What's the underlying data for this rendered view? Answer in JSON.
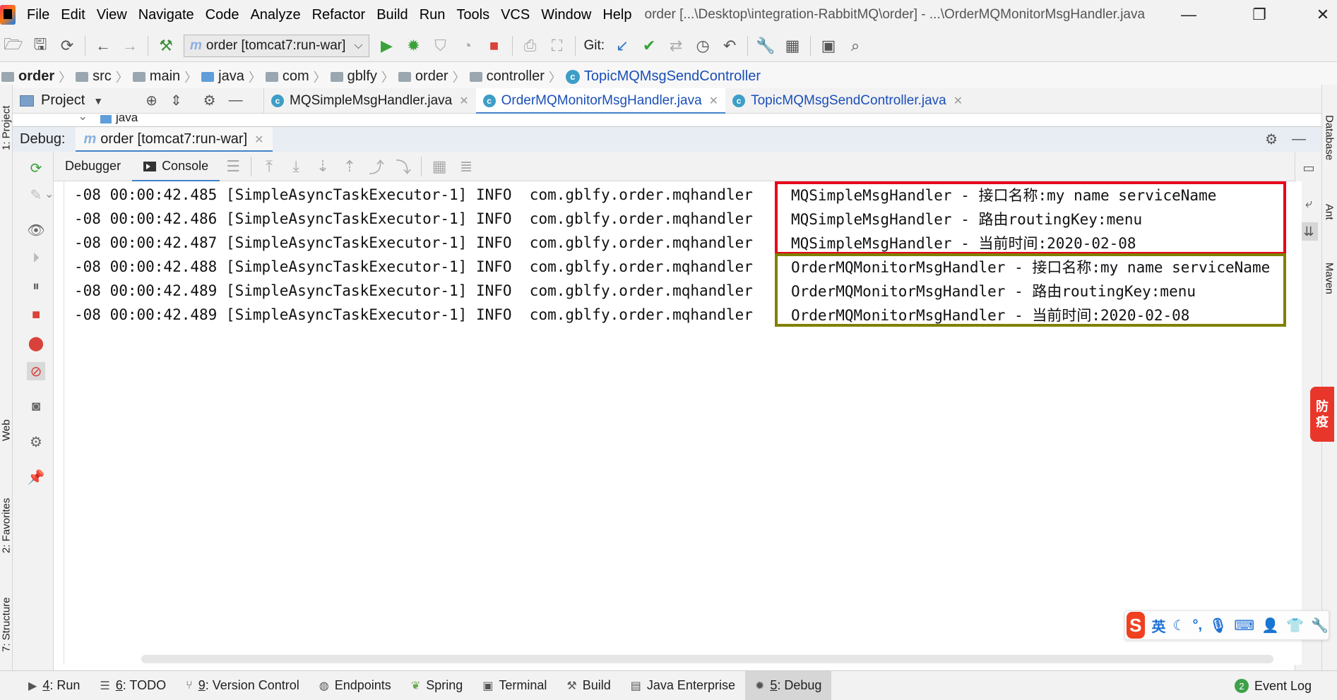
{
  "menubar": {
    "items": [
      "File",
      "Edit",
      "View",
      "Navigate",
      "Code",
      "Analyze",
      "Refactor",
      "Build",
      "Run",
      "Tools",
      "VCS",
      "Window",
      "Help"
    ],
    "title": "order [...\\Desktop\\integration-RabbitMQ\\order] - ...\\OrderMQMonitorMsgHandler.java",
    "minimize": "—",
    "restore": "❐",
    "close": "✕"
  },
  "toolbar": {
    "run_config": "order [tomcat7:run-war]",
    "git_label": "Git:"
  },
  "breadcrumb": {
    "items": [
      "order",
      "src",
      "main",
      "java",
      "com",
      "gblfy",
      "order",
      "controller"
    ],
    "class": "TopicMQMsgSendController"
  },
  "project_pane": {
    "label": "Project",
    "peek_node": "java"
  },
  "editor_tabs": [
    {
      "label": "MQSimpleMsgHandler.java",
      "active": false
    },
    {
      "label": "OrderMQMonitorMsgHandler.java",
      "active": true
    },
    {
      "label": "TopicMQMsgSendController.java",
      "active": false
    }
  ],
  "debug": {
    "label": "Debug:",
    "session": "order [tomcat7:run-war]",
    "subtabs": [
      "Debugger",
      "Console"
    ]
  },
  "console": {
    "lines": [
      {
        "prefix": "-08 00:00:42.485 [SimpleAsyncTaskExecutor-1] INFO  com.gblfy.order.mqhandler",
        "message": "MQSimpleMsgHandler - 接口名称:my name serviceName"
      },
      {
        "prefix": "-08 00:00:42.486 [SimpleAsyncTaskExecutor-1] INFO  com.gblfy.order.mqhandler",
        "message": "MQSimpleMsgHandler - 路由routingKey:menu"
      },
      {
        "prefix": "-08 00:00:42.487 [SimpleAsyncTaskExecutor-1] INFO  com.gblfy.order.mqhandler",
        "message": "MQSimpleMsgHandler - 当前时间:2020-02-08"
      },
      {
        "prefix": "-08 00:00:42.488 [SimpleAsyncTaskExecutor-1] INFO  com.gblfy.order.mqhandler",
        "message": "OrderMQMonitorMsgHandler - 接口名称:my name serviceName"
      },
      {
        "prefix": "-08 00:00:42.489 [SimpleAsyncTaskExecutor-1] INFO  com.gblfy.order.mqhandler",
        "message": "OrderMQMonitorMsgHandler - 路由routingKey:menu"
      },
      {
        "prefix": "-08 00:00:42.489 [SimpleAsyncTaskExecutor-1] INFO  com.gblfy.order.mqhandler",
        "message": "OrderMQMonitorMsgHandler - 当前时间:2020-02-08"
      }
    ],
    "highlight_colors": {
      "first_group": "#e8001c",
      "second_group": "#808000"
    }
  },
  "left_stripe": {
    "tabs": [
      "1: Project",
      "Web",
      "2: Favorites",
      "7: Structure"
    ]
  },
  "right_stripe": {
    "tabs": [
      "Database",
      "Ant",
      "Maven"
    ]
  },
  "bottom_tabs": [
    {
      "num": "4",
      "label": ": Run"
    },
    {
      "num": "6",
      "label": ": TODO"
    },
    {
      "num": "9",
      "label": ": Version Control"
    },
    {
      "num": "",
      "label": "Endpoints"
    },
    {
      "num": "",
      "label": "Spring"
    },
    {
      "num": "",
      "label": "Terminal"
    },
    {
      "num": "",
      "label": "Build"
    },
    {
      "num": "",
      "label": "Java Enterprise"
    },
    {
      "num": "5",
      "label": ": Debug"
    }
  ],
  "event_log": {
    "count": "2",
    "label": "Event Log"
  },
  "ime": {
    "logo": "S",
    "mode": "英"
  },
  "side_badge": {
    "line1": "防",
    "line2": "疫"
  },
  "colors": {
    "accent": "#4083c9",
    "link": "#1a4fb8"
  }
}
